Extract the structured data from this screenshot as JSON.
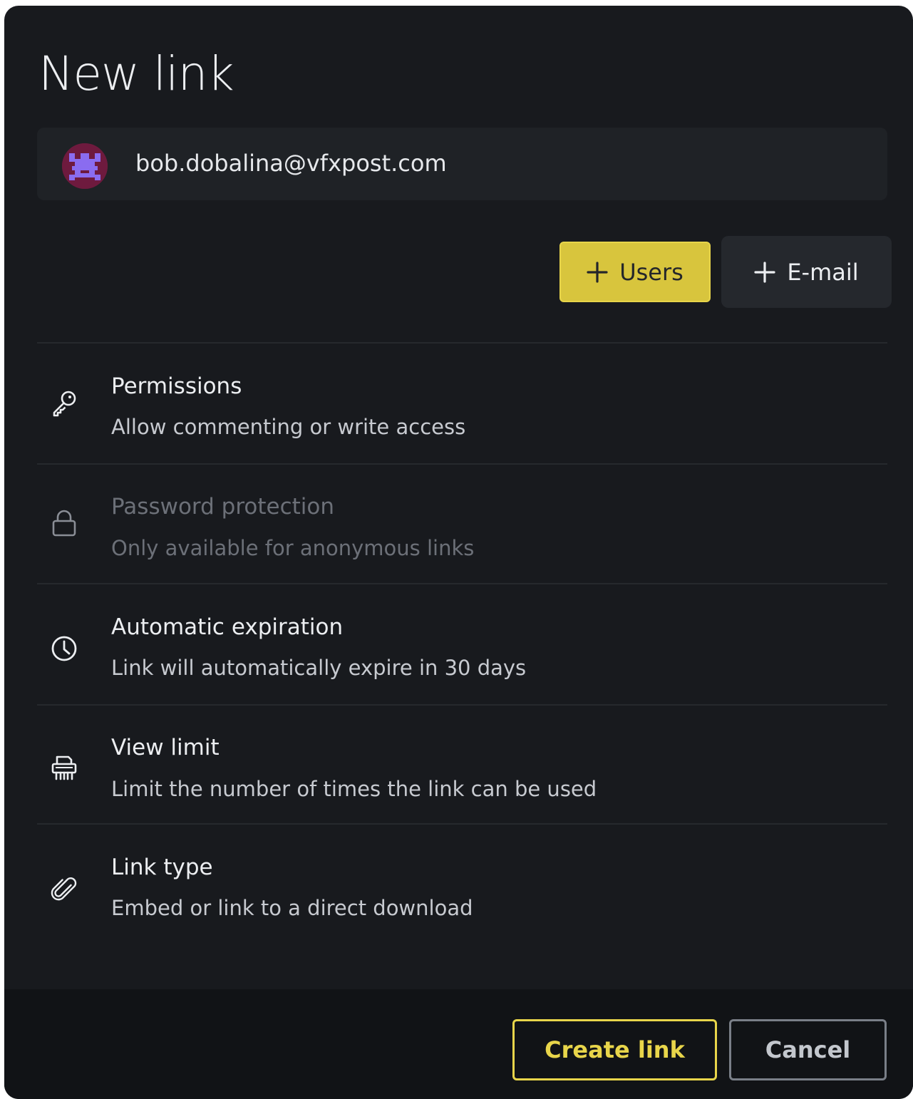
{
  "dialog": {
    "title": "New link"
  },
  "recipient": {
    "email": "bob.dobalina@vfxpost.com",
    "avatar_icon": "pixel-avatar"
  },
  "add_buttons": {
    "users_label": "Users",
    "email_label": "E-mail",
    "icon": "plus-icon"
  },
  "options": [
    {
      "icon": "key-icon",
      "title": "Permissions",
      "description": "Allow commenting or write access",
      "enabled": true
    },
    {
      "icon": "lock-icon",
      "title": "Password protection",
      "description": "Only available for anonymous links",
      "enabled": false
    },
    {
      "icon": "clock-icon",
      "title": "Automatic expiration",
      "description": "Link will automatically expire in 30 days",
      "enabled": true
    },
    {
      "icon": "shredder-icon",
      "title": "View limit",
      "description": "Limit the number of times the link can be used",
      "enabled": true
    },
    {
      "icon": "paperclip-icon",
      "title": "Link type",
      "description": "Embed or link to a direct download",
      "enabled": true
    }
  ],
  "footer": {
    "create_label": "Create link",
    "cancel_label": "Cancel"
  },
  "colors": {
    "dialog_bg": "#181a1e",
    "footer_bg": "#111316",
    "accent": "#e8d54a",
    "disabled_text": "#6c7078"
  }
}
